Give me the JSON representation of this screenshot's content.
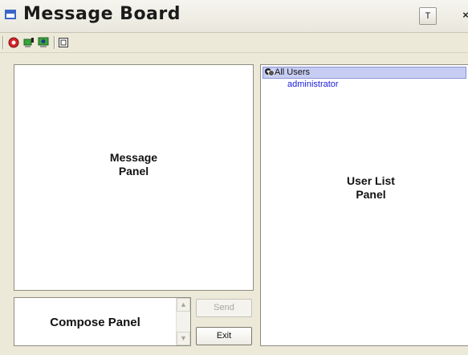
{
  "window": {
    "title": "Message Board",
    "pin_label": "T",
    "close_label": "×"
  },
  "toolbar": {
    "icons": [
      "red-circle-icon",
      "computer-key-icon",
      "computer-lock-icon",
      "frame-icon"
    ]
  },
  "message_panel": {
    "label": "Message\nPanel"
  },
  "compose_panel": {
    "label": "Compose Panel"
  },
  "buttons": {
    "send_label": "Send",
    "exit_label": "Exit"
  },
  "scroll": {
    "up": "▲",
    "down": "▼"
  },
  "user_list": {
    "label": "User List\nPanel",
    "group_label": "All Users",
    "users": [
      "administrator"
    ]
  }
}
